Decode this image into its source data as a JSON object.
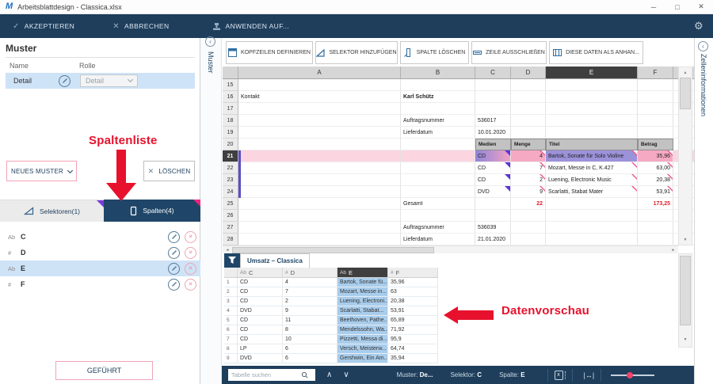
{
  "window": {
    "title": "Arbeitsblattdesign - Classica.xlsx"
  },
  "icons": {
    "logo": "M",
    "minimize": "─",
    "maximize": "□",
    "close": "✕",
    "accept_check": "✓",
    "cancel_x": "✕",
    "gear": "⚙",
    "delete_x": "✕",
    "scroll_up": "▲",
    "scroll_down": "▼",
    "scroll_left": "◄",
    "scroll_right": "►",
    "chevron_up": "∧",
    "chevron_down": "∨",
    "resize": "|↔|",
    "excel_x": "x",
    "pin": "‹"
  },
  "toolbar": {
    "accept": "AKZEPTIEREN",
    "cancel": "ABBRECHEN",
    "apply": "ANWENDEN AUF..."
  },
  "muster_panel": {
    "title": "Muster",
    "col_name": "Name",
    "col_role": "Rolle",
    "row": {
      "name": "Detail",
      "role": "Detail"
    },
    "new_button": "NEUES MUSTER",
    "delete_button": "LÖSCHEN",
    "tabs": {
      "selectors": "Selektoren(1)",
      "columns": "Spalten(4)"
    },
    "columns": [
      {
        "type": "Ab",
        "name": "C",
        "selected": false
      },
      {
        "type": "#",
        "name": "D",
        "selected": false
      },
      {
        "type": "Ab",
        "name": "E",
        "selected": true
      },
      {
        "type": "#",
        "name": "F",
        "selected": false
      }
    ],
    "gefuehrt_button": "GEFÜHRT"
  },
  "strips": {
    "left": "Muster",
    "right": "Zelleninformationen"
  },
  "annotations": {
    "spaltenliste": "Spaltenliste",
    "datenvorschau": "Datenvorschau"
  },
  "sheet_toolbar": [
    "KOPFZEILEN DEFINIEREN",
    "SELEKTOR HINZUFÜGEN",
    "SPALTE LÖSCHEN",
    "ZEILE AUSSCHLIEßEN",
    "DIESE DATEN ALS ANHAN..."
  ],
  "spreadsheet": {
    "col_headers": [
      "A",
      "B",
      "C",
      "D",
      "E",
      "F"
    ],
    "selected_col": "E",
    "selected_row": 21,
    "rows": [
      {
        "n": 15,
        "cells": []
      },
      {
        "n": 16,
        "cells": [
          {
            "c": "A",
            "t": "Kontakt"
          },
          {
            "c": "B",
            "t": "Karl Schütz",
            "s": "bold"
          }
        ]
      },
      {
        "n": 17,
        "cells": []
      },
      {
        "n": 18,
        "cells": [
          {
            "c": "B",
            "t": "Auftragsnummer"
          },
          {
            "c": "C",
            "t": "536017"
          }
        ]
      },
      {
        "n": 19,
        "cells": [
          {
            "c": "B",
            "t": "Lieferdatum"
          },
          {
            "c": "C",
            "t": "10.01.2020"
          }
        ]
      },
      {
        "n": 20,
        "cells": [
          {
            "c": "C",
            "t": "Medien",
            "s": "hdr"
          },
          {
            "c": "D",
            "t": "Menge",
            "s": "hdr"
          },
          {
            "c": "E",
            "t": "Titel",
            "s": "hdr"
          },
          {
            "c": "F",
            "t": "Betrag",
            "s": "hdr"
          }
        ]
      },
      {
        "n": 21,
        "sel": true,
        "mark": true,
        "cells": [
          {
            "c": "C",
            "t": "CD",
            "s": "selmedia tri-f"
          },
          {
            "c": "D",
            "t": "4",
            "s": "num selnum tri-o"
          },
          {
            "c": "E",
            "t": "Bartok, Sonate für Solo Violine",
            "s": "seltitle tri-o"
          },
          {
            "c": "F",
            "t": "35,96",
            "s": "num selamt tri-o"
          }
        ]
      },
      {
        "n": 22,
        "mark": true,
        "cells": [
          {
            "c": "C",
            "t": "CD",
            "s": "tri-f"
          },
          {
            "c": "D",
            "t": "7",
            "s": "num tri-o"
          },
          {
            "c": "E",
            "t": "Mozart, Messe in C, K.427",
            "s": "tri-o"
          },
          {
            "c": "F",
            "t": "63,00",
            "s": "num tri-o"
          }
        ]
      },
      {
        "n": 23,
        "mark": true,
        "cells": [
          {
            "c": "C",
            "t": "CD",
            "s": "tri-f"
          },
          {
            "c": "D",
            "t": "2",
            "s": "num tri-o"
          },
          {
            "c": "E",
            "t": "Luening, Electronic Music",
            "s": "tri-o"
          },
          {
            "c": "F",
            "t": "20,38",
            "s": "num tri-o"
          }
        ]
      },
      {
        "n": 24,
        "mark": true,
        "cells": [
          {
            "c": "C",
            "t": "DVD",
            "s": "tri-f"
          },
          {
            "c": "D",
            "t": "9",
            "s": "num tri-o"
          },
          {
            "c": "E",
            "t": "Scarlatti, Stabat Mater",
            "s": "tri-o"
          },
          {
            "c": "F",
            "t": "53,91",
            "s": "num tri-o"
          }
        ]
      },
      {
        "n": 25,
        "cells": [
          {
            "c": "B",
            "t": "Gesamt"
          },
          {
            "c": "D",
            "t": "22",
            "s": "num red"
          },
          {
            "c": "F",
            "t": "173,25",
            "s": "num red"
          }
        ]
      },
      {
        "n": 26,
        "cells": []
      },
      {
        "n": 27,
        "cells": [
          {
            "c": "B",
            "t": "Auftragsnummer"
          },
          {
            "c": "C",
            "t": "536039"
          }
        ]
      },
      {
        "n": 28,
        "cells": [
          {
            "c": "B",
            "t": "Lieferdatum"
          },
          {
            "c": "C",
            "t": "21.01.2020"
          }
        ]
      }
    ]
  },
  "preview": {
    "tab": "Umsatz – Classica",
    "headers": [
      {
        "type": "Ab",
        "name": "C",
        "selected": false
      },
      {
        "type": "#",
        "name": "D",
        "selected": false
      },
      {
        "type": "Ab",
        "name": "E",
        "selected": true
      },
      {
        "type": "#",
        "name": "F",
        "selected": false
      }
    ],
    "rows": [
      [
        "CD",
        "4",
        "Bartok, Sonate fü...",
        "35,96"
      ],
      [
        "CD",
        "7",
        "Mozart, Messe in...",
        "63"
      ],
      [
        "CD",
        "2",
        "Luening, Electroni...",
        "20,38"
      ],
      [
        "DVD",
        "9",
        "Scarlatti, Stabat...",
        "53,91"
      ],
      [
        "CD",
        "11",
        "Beethoven, Pathe...",
        "65,89"
      ],
      [
        "CD",
        "8",
        "Mendelssohn, Wa...",
        "71,92"
      ],
      [
        "CD",
        "10",
        "Pizzetti, Messa di...",
        "95,9"
      ],
      [
        "LP",
        "6",
        "Versch, Meisterw...",
        "64,74"
      ],
      [
        "DVD",
        "6",
        "Gershwin, Ein Am...",
        "35,94"
      ]
    ]
  },
  "statusbar": {
    "search_placeholder": "Tabelle suchen",
    "muster_label": "Muster:",
    "muster_value": "De...",
    "selektor_label": "Selektor:",
    "selektor_value": "C",
    "spalte_label": "Spalte:",
    "spalte_value": "E"
  },
  "colors": {
    "navy": "#1e3e5c",
    "tab_navy": "#1f4668",
    "annotation_red": "#e8112d",
    "selection_blue": "#cfe3f7",
    "preview_selection_blue": "#a9cdec",
    "row_pink": "#fbd5e0",
    "cell_pink": "#f5a9c3",
    "cell_purple": "#9c92da",
    "pattern_marker_purple": "#5b50c8",
    "triangle_purple": "#5c35d6",
    "triangle_pink": "#f05590"
  }
}
